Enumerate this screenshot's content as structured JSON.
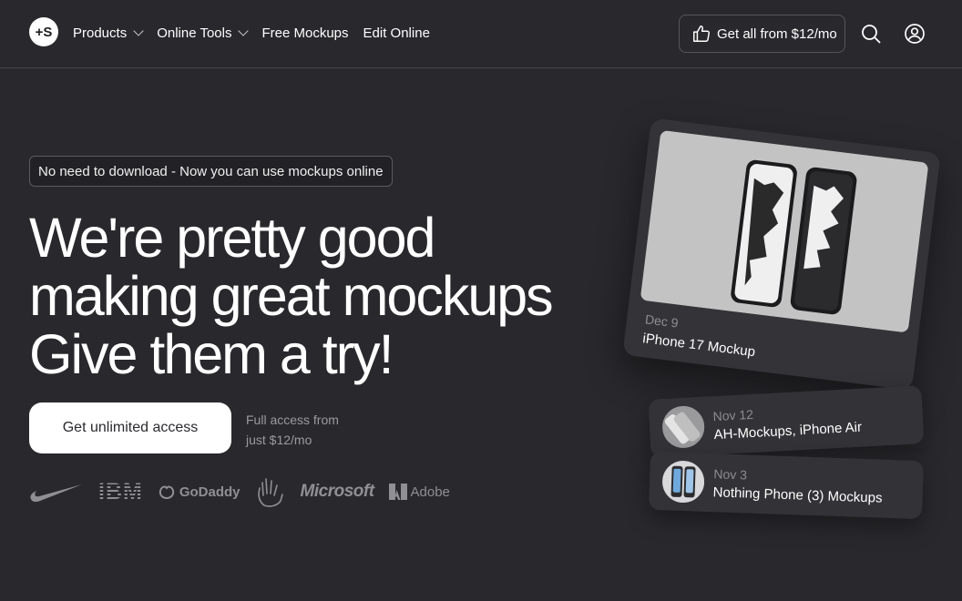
{
  "nav": {
    "logo": "+S",
    "menu": [
      {
        "label": "Products",
        "has_dropdown": true
      },
      {
        "label": "Online Tools",
        "has_dropdown": true
      },
      {
        "label": "Free Mockups",
        "has_dropdown": false
      },
      {
        "label": "Edit Online",
        "has_dropdown": false
      }
    ],
    "cta": "Get all from $12/mo"
  },
  "hero": {
    "pill": "No need to download - Now you can use mockups online",
    "headline": [
      "We're pretty good",
      "making great mockups",
      "Give them a try!"
    ],
    "button": "Get unlimited access",
    "note": [
      "Full access from",
      "just $12/mo"
    ]
  },
  "brands": {
    "godaddy": "GoDaddy",
    "ibm": "IBM",
    "microsoft": "Microsoft",
    "adobe": "Adobe"
  },
  "cards": {
    "main": {
      "date": "Dec 9",
      "title": "iPhone 17 Mockup"
    },
    "items": [
      {
        "date": "Nov 12",
        "title": "AH-Mockups, iPhone Air"
      },
      {
        "date": "Nov 3",
        "title": "Nothing Phone (3) Mockups"
      }
    ]
  },
  "colors": {
    "background": "#29292d",
    "card": "#343438",
    "accent": "#ffffff"
  }
}
